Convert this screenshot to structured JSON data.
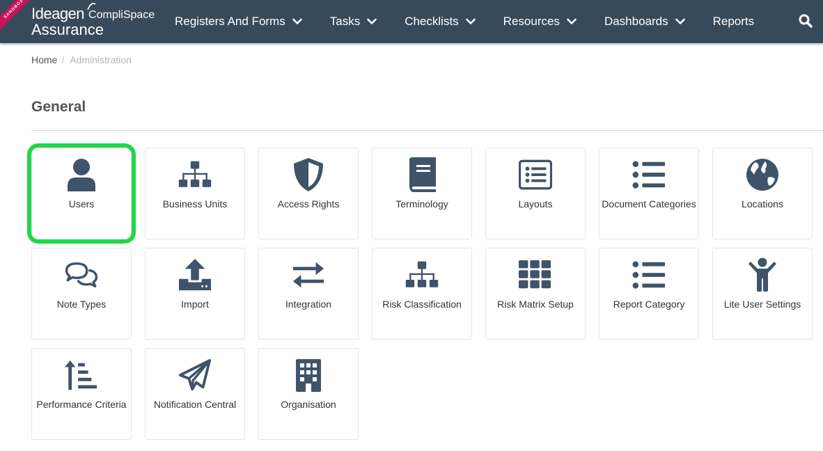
{
  "header": {
    "ribbon": "SANDBOX",
    "logo_brand": "Ideagen",
    "logo_product": "CompliSpace",
    "logo_sub": "Assurance",
    "nav": [
      {
        "label": "Registers And Forms",
        "has_dropdown": true
      },
      {
        "label": "Tasks",
        "has_dropdown": true
      },
      {
        "label": "Checklists",
        "has_dropdown": true
      },
      {
        "label": "Resources",
        "has_dropdown": true
      },
      {
        "label": "Dashboards",
        "has_dropdown": true
      },
      {
        "label": "Reports",
        "has_dropdown": false
      }
    ],
    "search_icon": "search-icon"
  },
  "breadcrumb": {
    "home": "Home",
    "separator": "/",
    "current": "Administration"
  },
  "section": {
    "title": "General"
  },
  "tiles": [
    {
      "label": "Users",
      "icon": "user-icon",
      "selected": true
    },
    {
      "label": "Business Units",
      "icon": "sitemap-icon"
    },
    {
      "label": "Access Rights",
      "icon": "shield-icon"
    },
    {
      "label": "Terminology",
      "icon": "book-icon"
    },
    {
      "label": "Layouts",
      "icon": "list-alt-icon"
    },
    {
      "label": "Document Categories",
      "icon": "list-icon"
    },
    {
      "label": "Locations",
      "icon": "globe-icon"
    },
    {
      "label": "Note Types",
      "icon": "comments-icon"
    },
    {
      "label": "Import",
      "icon": "upload-icon"
    },
    {
      "label": "Integration",
      "icon": "exchange-icon"
    },
    {
      "label": "Risk Classification",
      "icon": "sitemap-icon"
    },
    {
      "label": "Risk Matrix Setup",
      "icon": "grid-icon"
    },
    {
      "label": "Report Category",
      "icon": "list-icon"
    },
    {
      "label": "Lite User Settings",
      "icon": "child-icon"
    },
    {
      "label": "Performance Criteria",
      "icon": "sort-amount-up-icon"
    },
    {
      "label": "Notification Central",
      "icon": "paper-plane-icon"
    },
    {
      "label": "Organisation",
      "icon": "building-icon"
    }
  ],
  "colors": {
    "header_bg": "#374a5c",
    "icon": "#3f536a",
    "selected_outline": "#1fd845",
    "ribbon": "#c8125c"
  }
}
